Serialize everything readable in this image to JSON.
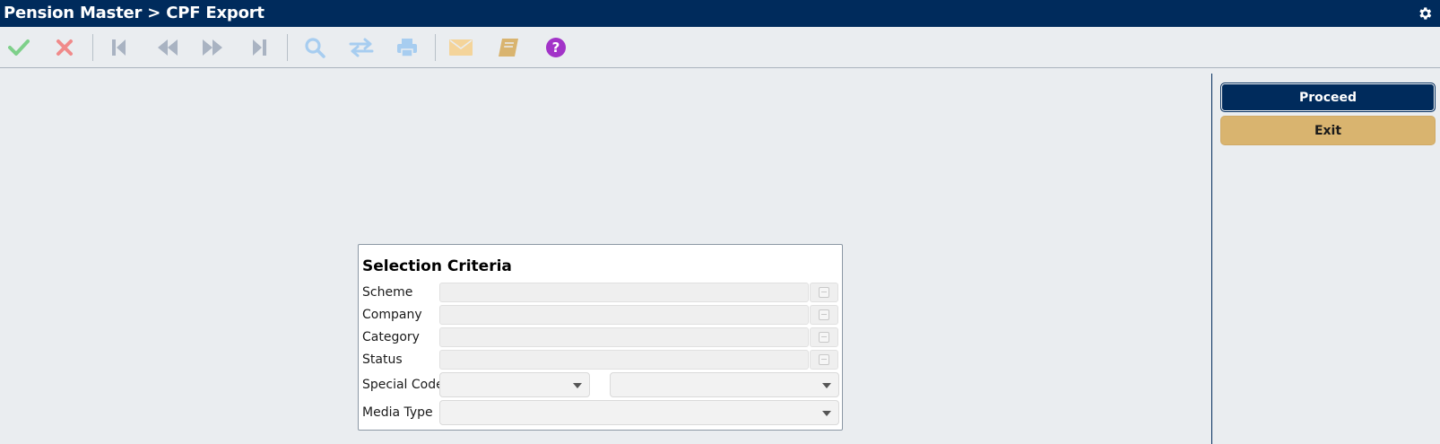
{
  "header": {
    "title": "Pension Master > CPF Export",
    "settings_icon": "gear-icon"
  },
  "toolbar": {
    "buttons": [
      {
        "name": "confirm",
        "icon": "check-icon",
        "color": "#7ed08a"
      },
      {
        "name": "cancel",
        "icon": "close-icon",
        "color": "#f08a8a"
      },
      {
        "name": "first-record",
        "icon": "first-record-icon",
        "color": "#a9b3c2"
      },
      {
        "name": "previous-record",
        "icon": "previous-record-icon",
        "color": "#a9b3c2"
      },
      {
        "name": "next-record",
        "icon": "next-record-icon",
        "color": "#a9b3c2"
      },
      {
        "name": "last-record",
        "icon": "last-record-icon",
        "color": "#a9b3c2"
      },
      {
        "name": "search",
        "icon": "search-icon",
        "color": "#a7cdf0"
      },
      {
        "name": "swap",
        "icon": "swap-icon",
        "color": "#a7cdf0"
      },
      {
        "name": "print",
        "icon": "print-icon",
        "color": "#a7cdf0"
      },
      {
        "name": "email",
        "icon": "envelope-icon",
        "color": "#f4d49a"
      },
      {
        "name": "notes",
        "icon": "notebook-icon",
        "color": "#d9b46f"
      },
      {
        "name": "help",
        "icon": "help-icon",
        "color": "#a233c8"
      }
    ]
  },
  "actions": {
    "proceed_label": "Proceed",
    "exit_label": "Exit"
  },
  "selection_criteria": {
    "title": "Selection Criteria",
    "scheme_label": "Scheme",
    "scheme_value": "",
    "company_label": "Company",
    "company_value": "",
    "category_label": "Category",
    "category_value": "",
    "status_label": "Status",
    "status_value": "",
    "special_code_label": "Special Code",
    "special_code_value_1": "",
    "special_code_value_2": "",
    "media_type_label": "Media Type",
    "media_type_value": ""
  },
  "colors": {
    "brand": "#002b5c",
    "exit_button": "#d9b46f",
    "background": "#eaedf0"
  }
}
